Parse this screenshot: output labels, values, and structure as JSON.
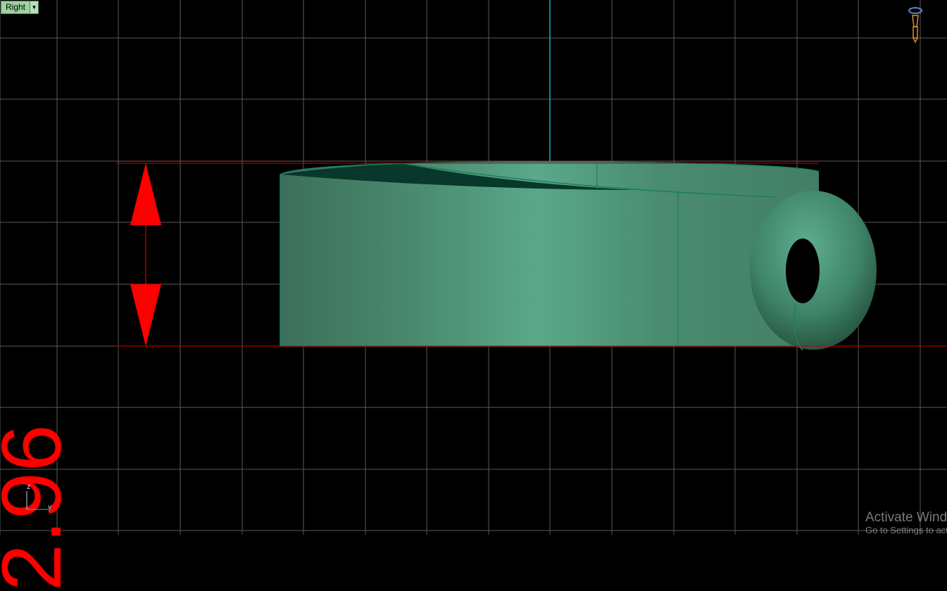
{
  "viewport": {
    "name": "Right",
    "dropdown_icon": "chevron-down-icon"
  },
  "dimension": {
    "value": "2.96"
  },
  "axis_triad": {
    "z_label": "z",
    "y_label": "y"
  },
  "watermark": {
    "line1": "Activate Windows",
    "line2": "Go to Settings to activate Windows."
  },
  "colors": {
    "background": "#000000",
    "grid": "#5a5a5a",
    "model": "#4a9477",
    "dimension": "#ff0000",
    "axis": "#1fa8c8"
  }
}
